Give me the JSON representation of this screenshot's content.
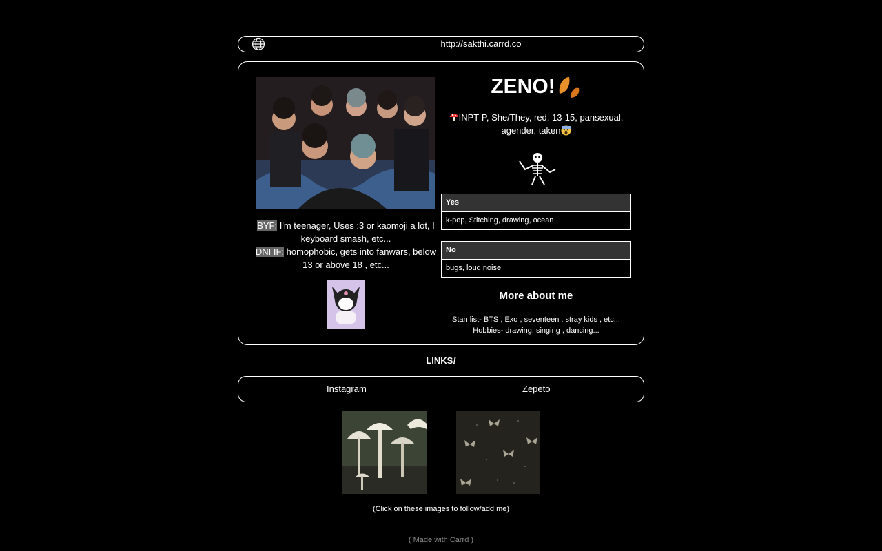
{
  "url_bar": {
    "url": "http://sakthi.carrd.co",
    "icon": "globe-icon"
  },
  "profile": {
    "photo_icon": "group-photo",
    "byf_label": "BYF:",
    "byf_text": " I'm teenager, Uses :3 or kaomoji a lot, I keyboard smash, etc...",
    "dni_label": "DNI IF:",
    "dni_text": " homophobic, gets into fanwars, below 13 or above 18 , etc...",
    "sticker_icon": "kuromi-sticker",
    "title": "ZENO!",
    "title_icon": "leaf-icon",
    "identity_icon": "mushroom-emoji",
    "identity": "INPT-P, She/They, red, 13-15, pansexual, agender, taken",
    "identity_end_icon": "scream-emoji",
    "skeleton_icon": "skeleton-icon",
    "yes": {
      "header": "Yes",
      "value": "k-pop, Stitching, drawing, ocean"
    },
    "no": {
      "header": "No",
      "value": "bugs, loud noise"
    },
    "more_heading": "More about me",
    "stan_list": "Stan list- BTS , Exo , seventeen , stray kids , etc...",
    "hobbies": "Hobbies- drawing, singing , dancing..."
  },
  "links": {
    "heading": "LINKS",
    "heading_mark": "!",
    "items": [
      "Instagram",
      "Zepeto"
    ]
  },
  "tiles": [
    "mushrooms-image",
    "butterflies-image"
  ],
  "hint": "(Click on these images to follow/add me)",
  "footer": "( Made with Carrd )",
  "colors": {
    "background": "#000000",
    "text": "#ffffff",
    "highlight": "#666666",
    "table_header": "#333333",
    "footer": "#888888"
  }
}
